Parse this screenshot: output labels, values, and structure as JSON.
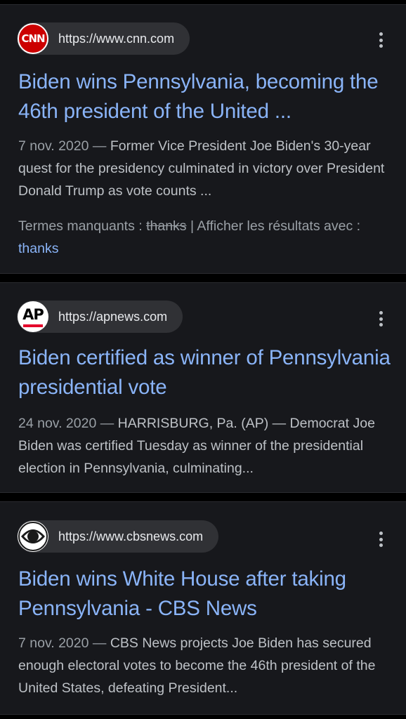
{
  "results": [
    {
      "source_logo": "CNN",
      "url": "https://www.cnn.com",
      "title": "Biden wins Pennsylvania, becoming the 46th president of the United ...",
      "date": "7 nov. 2020",
      "date_separator": " — ",
      "snippet": "Former Vice President Joe Biden's 30-year quest for the presidency culminated in victory over President Donald Trump as vote counts ...",
      "missing_terms_label": "Termes manquants : ",
      "missing_term": "thanks",
      "show_results_label": " | Afficher les résultats avec : ",
      "show_results_term": "thanks",
      "icon": "cnn-logo-icon"
    },
    {
      "source_logo": "AP",
      "url": "https://apnews.com",
      "title": "Biden certified as winner of Pennsylvania presidential vote",
      "date": "24 nov. 2020",
      "date_separator": " — ",
      "snippet": "HARRISBURG, Pa. (AP) — Democrat Joe Biden was certified Tuesday as winner of the presidential election in Pennsylvania, culminating...",
      "icon": "ap-logo-icon"
    },
    {
      "url": "https://www.cbsnews.com",
      "title": "Biden wins White House after taking Pennsylvania - CBS News",
      "date": "7 nov. 2020",
      "date_separator": " — ",
      "snippet": "CBS News projects Joe Biden has secured enough electoral votes to become the 46th president of the United States, defeating President...",
      "icon": "cbs-eye-logo-icon"
    }
  ],
  "icons": {
    "more_options": "more-vert-icon"
  },
  "colors": {
    "background": "#000000",
    "card": "#17181c",
    "link": "#8ab4f8",
    "text": "#bdc1c6",
    "muted": "#9aa0a6",
    "cnn_red": "#cc0000",
    "ap_red": "#e4002b"
  }
}
